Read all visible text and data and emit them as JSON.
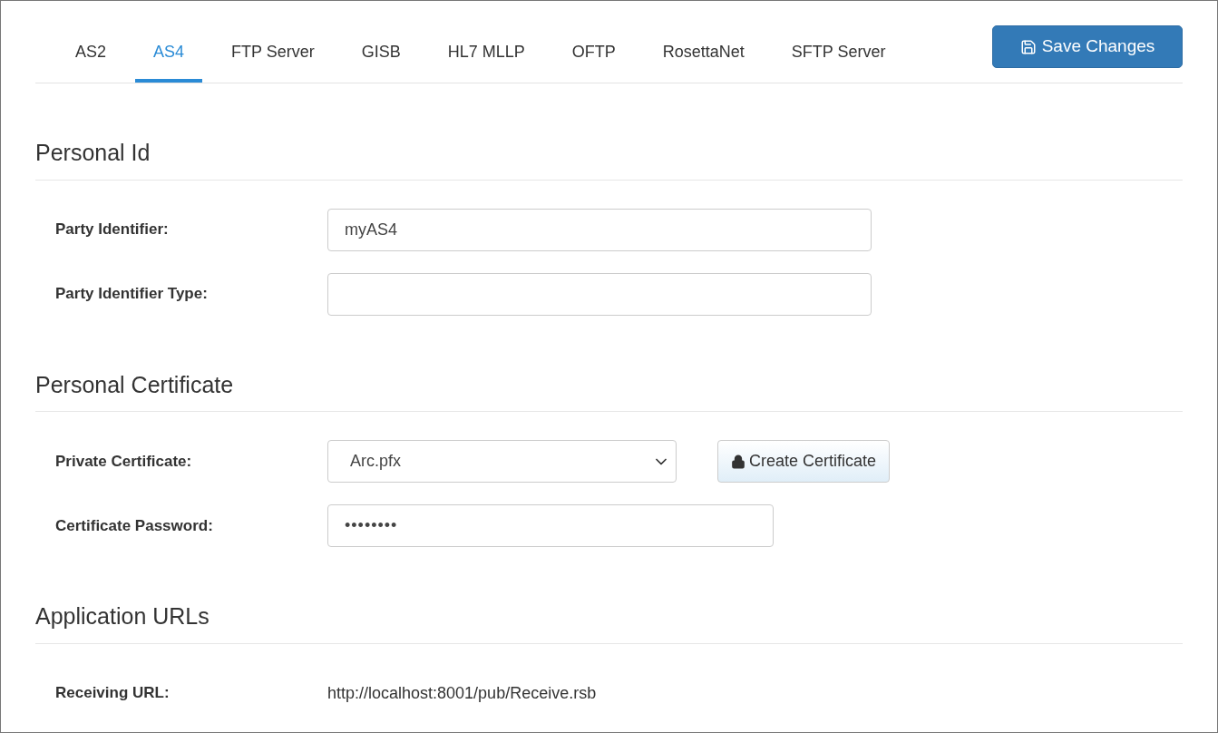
{
  "tabs": [
    {
      "label": "AS2",
      "selected": false
    },
    {
      "label": "AS4",
      "selected": true
    },
    {
      "label": "FTP Server",
      "selected": false
    },
    {
      "label": "GISB",
      "selected": false
    },
    {
      "label": "HL7 MLLP",
      "selected": false
    },
    {
      "label": "OFTP",
      "selected": false
    },
    {
      "label": "RosettaNet",
      "selected": false
    },
    {
      "label": "SFTP Server",
      "selected": false
    }
  ],
  "save_button": {
    "label": "Save Changes"
  },
  "sections": [
    {
      "title": "Personal Id",
      "rows": [
        {
          "kind": "input",
          "label": "Party Identifier:",
          "value": "myAS4"
        },
        {
          "kind": "input",
          "label": "Party Identifier Type:"
        }
      ]
    },
    {
      "title": "Personal Certificate",
      "rows": [
        {
          "kind": "select",
          "label": "Private Certificate:",
          "value": "Arc.pfx",
          "button": "Create Certificate"
        },
        {
          "kind": "password",
          "label": "Certificate Password:",
          "value": "••••••••"
        }
      ]
    },
    {
      "title": "Application URLs",
      "rows": [
        {
          "kind": "text",
          "label": "Receiving URL:",
          "value": "http://localhost:8001/pub/Receive.rsb"
        }
      ]
    }
  ]
}
